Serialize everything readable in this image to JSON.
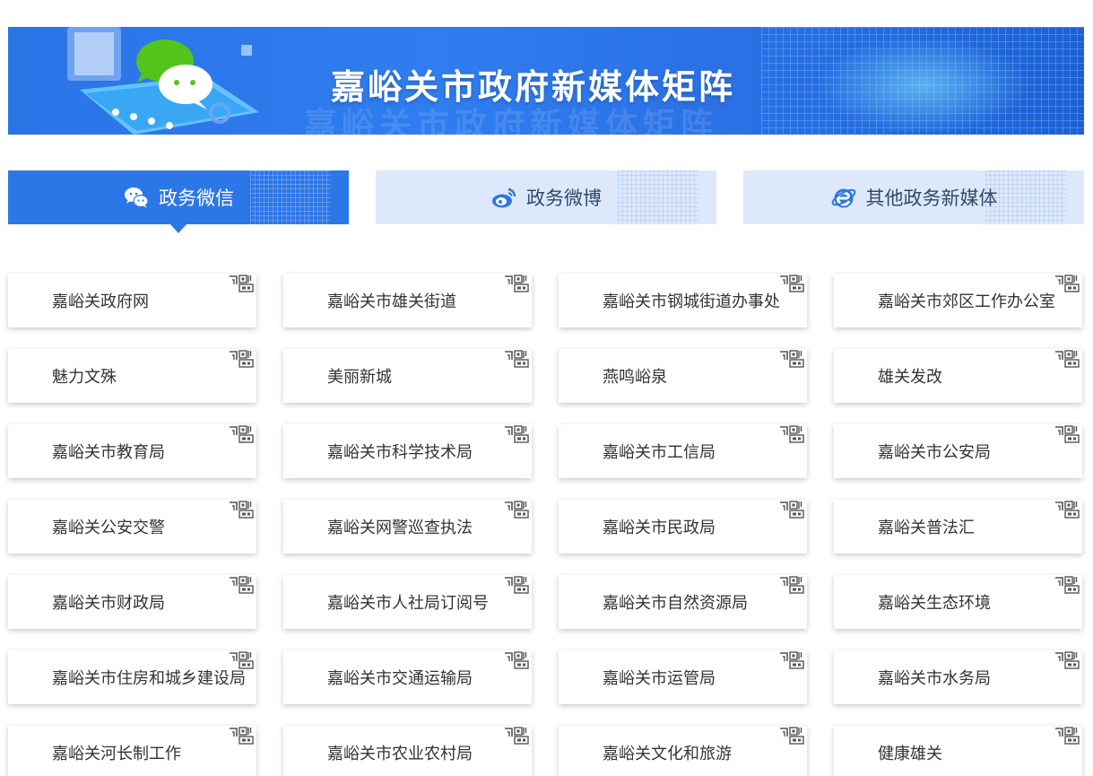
{
  "banner": {
    "title": "嘉峪关市政府新媒体矩阵"
  },
  "tabs": [
    {
      "label": "政务微信",
      "icon": "wechat-icon",
      "active": true
    },
    {
      "label": "政务微博",
      "icon": "weibo-icon",
      "active": false
    },
    {
      "label": "其他政务新媒体",
      "icon": "ie-browser-icon",
      "active": false
    }
  ],
  "cards": [
    "嘉峪关政府网",
    "嘉峪关市雄关街道",
    "嘉峪关市钢城街道办事处",
    "嘉峪关市郊区工作办公室",
    "魅力文殊",
    "美丽新城",
    "燕鸣峪泉",
    "雄关发改",
    "嘉峪关市教育局",
    "嘉峪关市科学技术局",
    "嘉峪关市工信局",
    "嘉峪关市公安局",
    "嘉峪关公安交警",
    "嘉峪关网警巡查执法",
    "嘉峪关市民政局",
    "嘉峪关普法汇",
    "嘉峪关市财政局",
    "嘉峪关市人社局订阅号",
    "嘉峪关市自然资源局",
    "嘉峪关生态环境",
    "嘉峪关市住房和城乡建设局",
    "嘉峪关市交通运输局",
    "嘉峪关市运管局",
    "嘉峪关市水务局",
    "嘉峪关河长制工作",
    "嘉峪关市农业农村局",
    "嘉峪关文化和旅游",
    "健康雄关"
  ],
  "colors": {
    "primary": "#2c77e8",
    "tab_inactive_bg": "#dde9fb",
    "card_text": "#333333"
  }
}
